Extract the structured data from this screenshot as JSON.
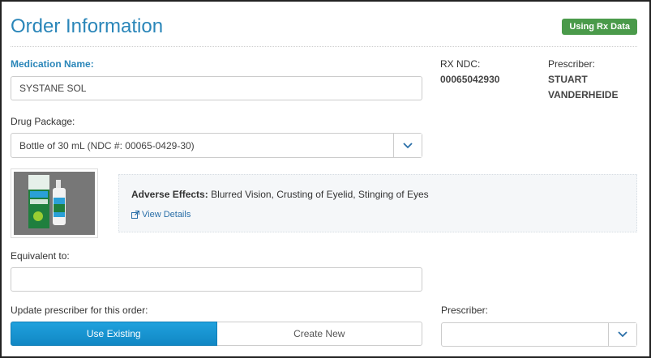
{
  "header": {
    "title": "Order Information",
    "badge": "Using Rx Data"
  },
  "medication": {
    "label": "Medication Name:",
    "value": "SYSTANE SOL"
  },
  "rx_ndc": {
    "label": "RX NDC:",
    "value": "00065042930"
  },
  "prescriber_info": {
    "label": "Prescriber:",
    "first": "STUART",
    "last": "VANDERHEIDE"
  },
  "package": {
    "label": "Drug Package:",
    "value": "Bottle of 30 mL (NDC #: 00065-0429-30)"
  },
  "effects": {
    "label": "Adverse Effects:",
    "text": "Blurred Vision, Crusting of Eyelid, Stinging of Eyes",
    "link": "View Details"
  },
  "equivalent": {
    "label": "Equivalent to:",
    "value": ""
  },
  "update": {
    "label": "Update prescriber for this order:",
    "options": [
      "Use Existing",
      "Create New"
    ],
    "selected": "Use Existing"
  },
  "prescriber_select": {
    "label": "Prescriber:",
    "value": ""
  },
  "product_image": {
    "brand": "Systane"
  },
  "colors": {
    "accent": "#2a86b9",
    "badge": "#4a9a4a",
    "primary_button": "#1597d2"
  },
  "icons": [
    "chevron-down-icon",
    "external-link-icon"
  ]
}
